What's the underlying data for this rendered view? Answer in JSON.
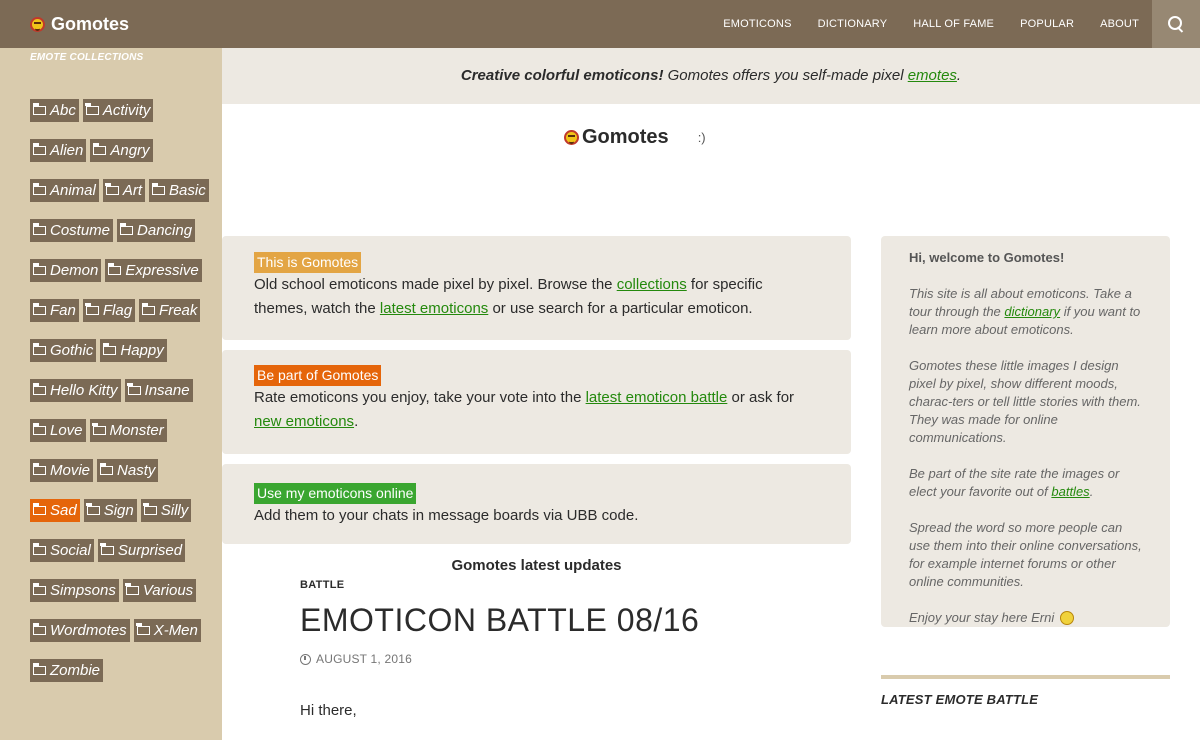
{
  "header": {
    "brand": "Gomotes",
    "nav": [
      "EMOTICONS",
      "DICTIONARY",
      "HALL OF FAME",
      "POPULAR",
      "ABOUT"
    ]
  },
  "sidebar": {
    "heading": "EMOTE COLLECTIONS",
    "tags": [
      "Abc",
      "Activity",
      "Alien",
      "Angry",
      "Animal",
      "Art",
      "Basic",
      "Costume",
      "Dancing",
      "Demon",
      "Expressive",
      "Fan",
      "Flag",
      "Freak",
      "Gothic",
      "Happy",
      "Hello Kitty",
      "Insane",
      "Love",
      "Monster",
      "Movie",
      "Nasty",
      "Sad",
      "Sign",
      "Silly",
      "Social",
      "Surprised",
      "Simpsons",
      "Various",
      "Wordmotes",
      "X-Men",
      "Zombie"
    ],
    "active_tag": "Sad"
  },
  "tagline": {
    "bold": "Creative colorful emoticons!",
    "text": "Gomotes offers you self-made pixel",
    "link": "emotes",
    "end": "."
  },
  "logo": {
    "text": "Gomotes",
    "emote": ":)"
  },
  "cards": {
    "c1": {
      "badge": "This is Gomotes",
      "t1": "Old school emoticons made pixel by pixel. Browse the",
      "link1": "collections",
      "t2": "for specific themes, watch the",
      "link2": "latest emoticons",
      "t3": "or use search for a particular emoticon."
    },
    "c2": {
      "badge": "Be part of Gomotes",
      "t1": "Rate emoticons you enjoy, take your vote into the",
      "link1": "latest emoticon battle",
      "t2": "or ask for",
      "link2": "new emoticons",
      "t3": "."
    },
    "c3": {
      "badge": "Use my emoticons online",
      "t1": "Add them to your chats in message boards via UBB code."
    }
  },
  "updates": {
    "title": "Gomotes latest updates",
    "category": "BATTLE",
    "post_title": "EMOTICON BATTLE 08/16",
    "date": "AUGUST 1, 2016",
    "body": "Hi there,"
  },
  "widget": {
    "title": "Hi, welcome to Gomotes!",
    "p1a": "This site is all about emoticons. Take a tour through the",
    "p1link": "dictionary",
    "p1b": "if you want to learn more about emoticons.",
    "p2": "Gomotes these little images I design pixel by pixel, show different moods, charac-ters or tell little stories with them. They was made for online communications.",
    "p3a": "Be part of the site rate the images or elect your favorite out of",
    "p3link": "battles",
    "p3b": ".",
    "p4": "Spread the word so more people can use them into their online conversations, for example internet forums or other online communities.",
    "p5": "Enjoy your stay here Erni"
  },
  "battle": {
    "title": "LATEST EMOTE BATTLE"
  },
  "colors": {
    "header": "#7c6a55",
    "sidebar": "#d9cbad",
    "tag": "#7b6a55",
    "active_tag": "#e5650a",
    "link": "#24890d"
  }
}
